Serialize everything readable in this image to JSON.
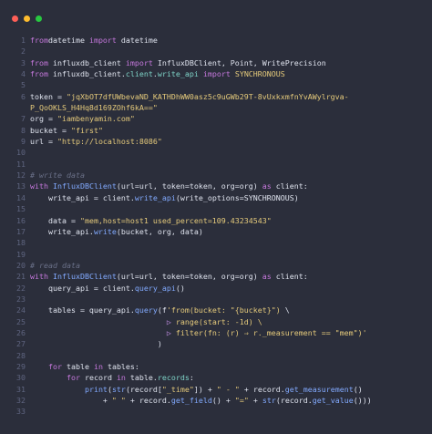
{
  "window": {
    "controls": {
      "close_color": "#ff5f57",
      "minimize_color": "#febc2e",
      "maximize_color": "#28c840"
    }
  },
  "editor": {
    "language": "python",
    "lines": [
      {
        "n": "1",
        "segs": [
          [
            "kw",
            "from"
          ],
          [
            "",
            "datetime"
          ],
          [
            "kw",
            " import "
          ],
          [
            "",
            "datetime"
          ]
        ]
      },
      {
        "n": "2",
        "segs": []
      },
      {
        "n": "3",
        "segs": [
          [
            "kw",
            "from"
          ],
          [
            "",
            " influxdb_client "
          ],
          [
            "kw",
            "import"
          ],
          [
            "",
            " InfluxDBClient, Point, WritePrecision"
          ]
        ]
      },
      {
        "n": "4",
        "segs": [
          [
            "kw",
            "from"
          ],
          [
            "",
            " influxdb_client."
          ],
          [
            "attr",
            "client"
          ],
          [
            "",
            "."
          ],
          [
            "attr",
            "write_api"
          ],
          [
            "kw",
            " import"
          ],
          [
            "",
            ""
          ],
          [
            "str",
            " SYNCHRONOUS"
          ]
        ]
      },
      {
        "n": "5",
        "segs": []
      },
      {
        "n": "6",
        "segs": [
          [
            "",
            "token = "
          ],
          [
            "str",
            "\"jqXbOT7dfUWbevaND_KATHDhWW0asz5c9uGWb29T-8vUxkxmfnYvAWylrgva-"
          ]
        ]
      },
      {
        "n": "",
        "segs": [
          [
            "str",
            "P_QoOKLS_H4Hq8d169ZOhf6kA==\""
          ]
        ]
      },
      {
        "n": "7",
        "segs": [
          [
            "",
            "org = "
          ],
          [
            "str",
            "\"iambenyamin.com\""
          ]
        ]
      },
      {
        "n": "8",
        "segs": [
          [
            "",
            "bucket = "
          ],
          [
            "str",
            "\"first\""
          ]
        ]
      },
      {
        "n": "9",
        "segs": [
          [
            "",
            "url = "
          ],
          [
            "str",
            "\"http://localhost:8086\""
          ]
        ]
      },
      {
        "n": "10",
        "segs": []
      },
      {
        "n": "11",
        "segs": []
      },
      {
        "n": "12",
        "segs": [
          [
            "com",
            "# write data"
          ]
        ]
      },
      {
        "n": "13",
        "segs": [
          [
            "kw",
            "with"
          ],
          [
            "",
            " "
          ],
          [
            "fn",
            "InfluxDBClient"
          ],
          [
            "",
            "(url=url, token=token, org=org) "
          ],
          [
            "kw",
            "as"
          ],
          [
            "",
            " client:"
          ]
        ]
      },
      {
        "n": "14",
        "segs": [
          [
            "",
            "    write_api = client."
          ],
          [
            "fn",
            "write_api"
          ],
          [
            "",
            "(write_options=SYNCHRONOUS)"
          ]
        ]
      },
      {
        "n": "15",
        "segs": []
      },
      {
        "n": "16",
        "segs": [
          [
            "",
            "    data = "
          ],
          [
            "str",
            "\"mem,host=host1 used_percent=109.43234543\""
          ]
        ]
      },
      {
        "n": "17",
        "segs": [
          [
            "",
            "    write_api."
          ],
          [
            "fn",
            "write"
          ],
          [
            "",
            "(bucket, org, data)"
          ]
        ]
      },
      {
        "n": "18",
        "segs": []
      },
      {
        "n": "19",
        "segs": []
      },
      {
        "n": "20",
        "segs": [
          [
            "com",
            "# read data"
          ]
        ]
      },
      {
        "n": "21",
        "segs": [
          [
            "kw",
            "with"
          ],
          [
            "",
            " "
          ],
          [
            "fn",
            "InfluxDBClient"
          ],
          [
            "",
            "(url=url, token=token, org=org) "
          ],
          [
            "kw",
            "as"
          ],
          [
            "",
            " client:"
          ]
        ]
      },
      {
        "n": "22",
        "segs": [
          [
            "",
            "    query_api = client."
          ],
          [
            "fn",
            "query_api"
          ],
          [
            "",
            "()"
          ]
        ]
      },
      {
        "n": "23",
        "segs": []
      },
      {
        "n": "24",
        "segs": [
          [
            "",
            "    tables = query_api."
          ],
          [
            "fn",
            "query"
          ],
          [
            "",
            "(f"
          ],
          [
            "str",
            "'from(bucket: \"{bucket}\")"
          ],
          [
            "",
            " \\"
          ]
        ]
      },
      {
        "n": "25",
        "segs": [
          [
            "",
            "                              "
          ],
          [
            "op",
            "▷"
          ],
          [
            "str",
            " range(start: -1d) \\"
          ]
        ]
      },
      {
        "n": "26",
        "segs": [
          [
            "",
            "                              "
          ],
          [
            "op",
            "▷"
          ],
          [
            "str",
            " filter(fn: (r) ⇒ r._measurement == \"mem\")'"
          ]
        ]
      },
      {
        "n": "27",
        "segs": [
          [
            "",
            "                            )"
          ]
        ]
      },
      {
        "n": "28",
        "segs": []
      },
      {
        "n": "29",
        "segs": [
          [
            "",
            "    "
          ],
          [
            "kw",
            "for"
          ],
          [
            "",
            " table "
          ],
          [
            "kw",
            "in"
          ],
          [
            "",
            " tables:"
          ]
        ]
      },
      {
        "n": "30",
        "segs": [
          [
            "",
            "        "
          ],
          [
            "kw",
            "for"
          ],
          [
            "",
            " record "
          ],
          [
            "kw",
            "in"
          ],
          [
            "",
            " table."
          ],
          [
            "attr",
            "records"
          ],
          [
            "",
            ":"
          ]
        ]
      },
      {
        "n": "31",
        "segs": [
          [
            "",
            "            "
          ],
          [
            "fn",
            "print"
          ],
          [
            "",
            "("
          ],
          [
            "fn",
            "str"
          ],
          [
            "",
            "(record["
          ],
          [
            "str",
            "\"_time\""
          ],
          [
            "",
            "]) + "
          ],
          [
            "str",
            "\" - \""
          ],
          [
            "",
            " + record."
          ],
          [
            "fn",
            "get_measurement"
          ],
          [
            "",
            "()"
          ]
        ]
      },
      {
        "n": "32",
        "segs": [
          [
            "",
            "                + "
          ],
          [
            "str",
            "\" \""
          ],
          [
            "",
            " + record."
          ],
          [
            "fn",
            "get_field"
          ],
          [
            "",
            "() + "
          ],
          [
            "str",
            "\"=\""
          ],
          [
            "",
            " + "
          ],
          [
            "fn",
            "str"
          ],
          [
            "",
            "(record."
          ],
          [
            "fn",
            "get_value"
          ],
          [
            "",
            "()))"
          ]
        ]
      },
      {
        "n": "33",
        "segs": []
      }
    ]
  }
}
